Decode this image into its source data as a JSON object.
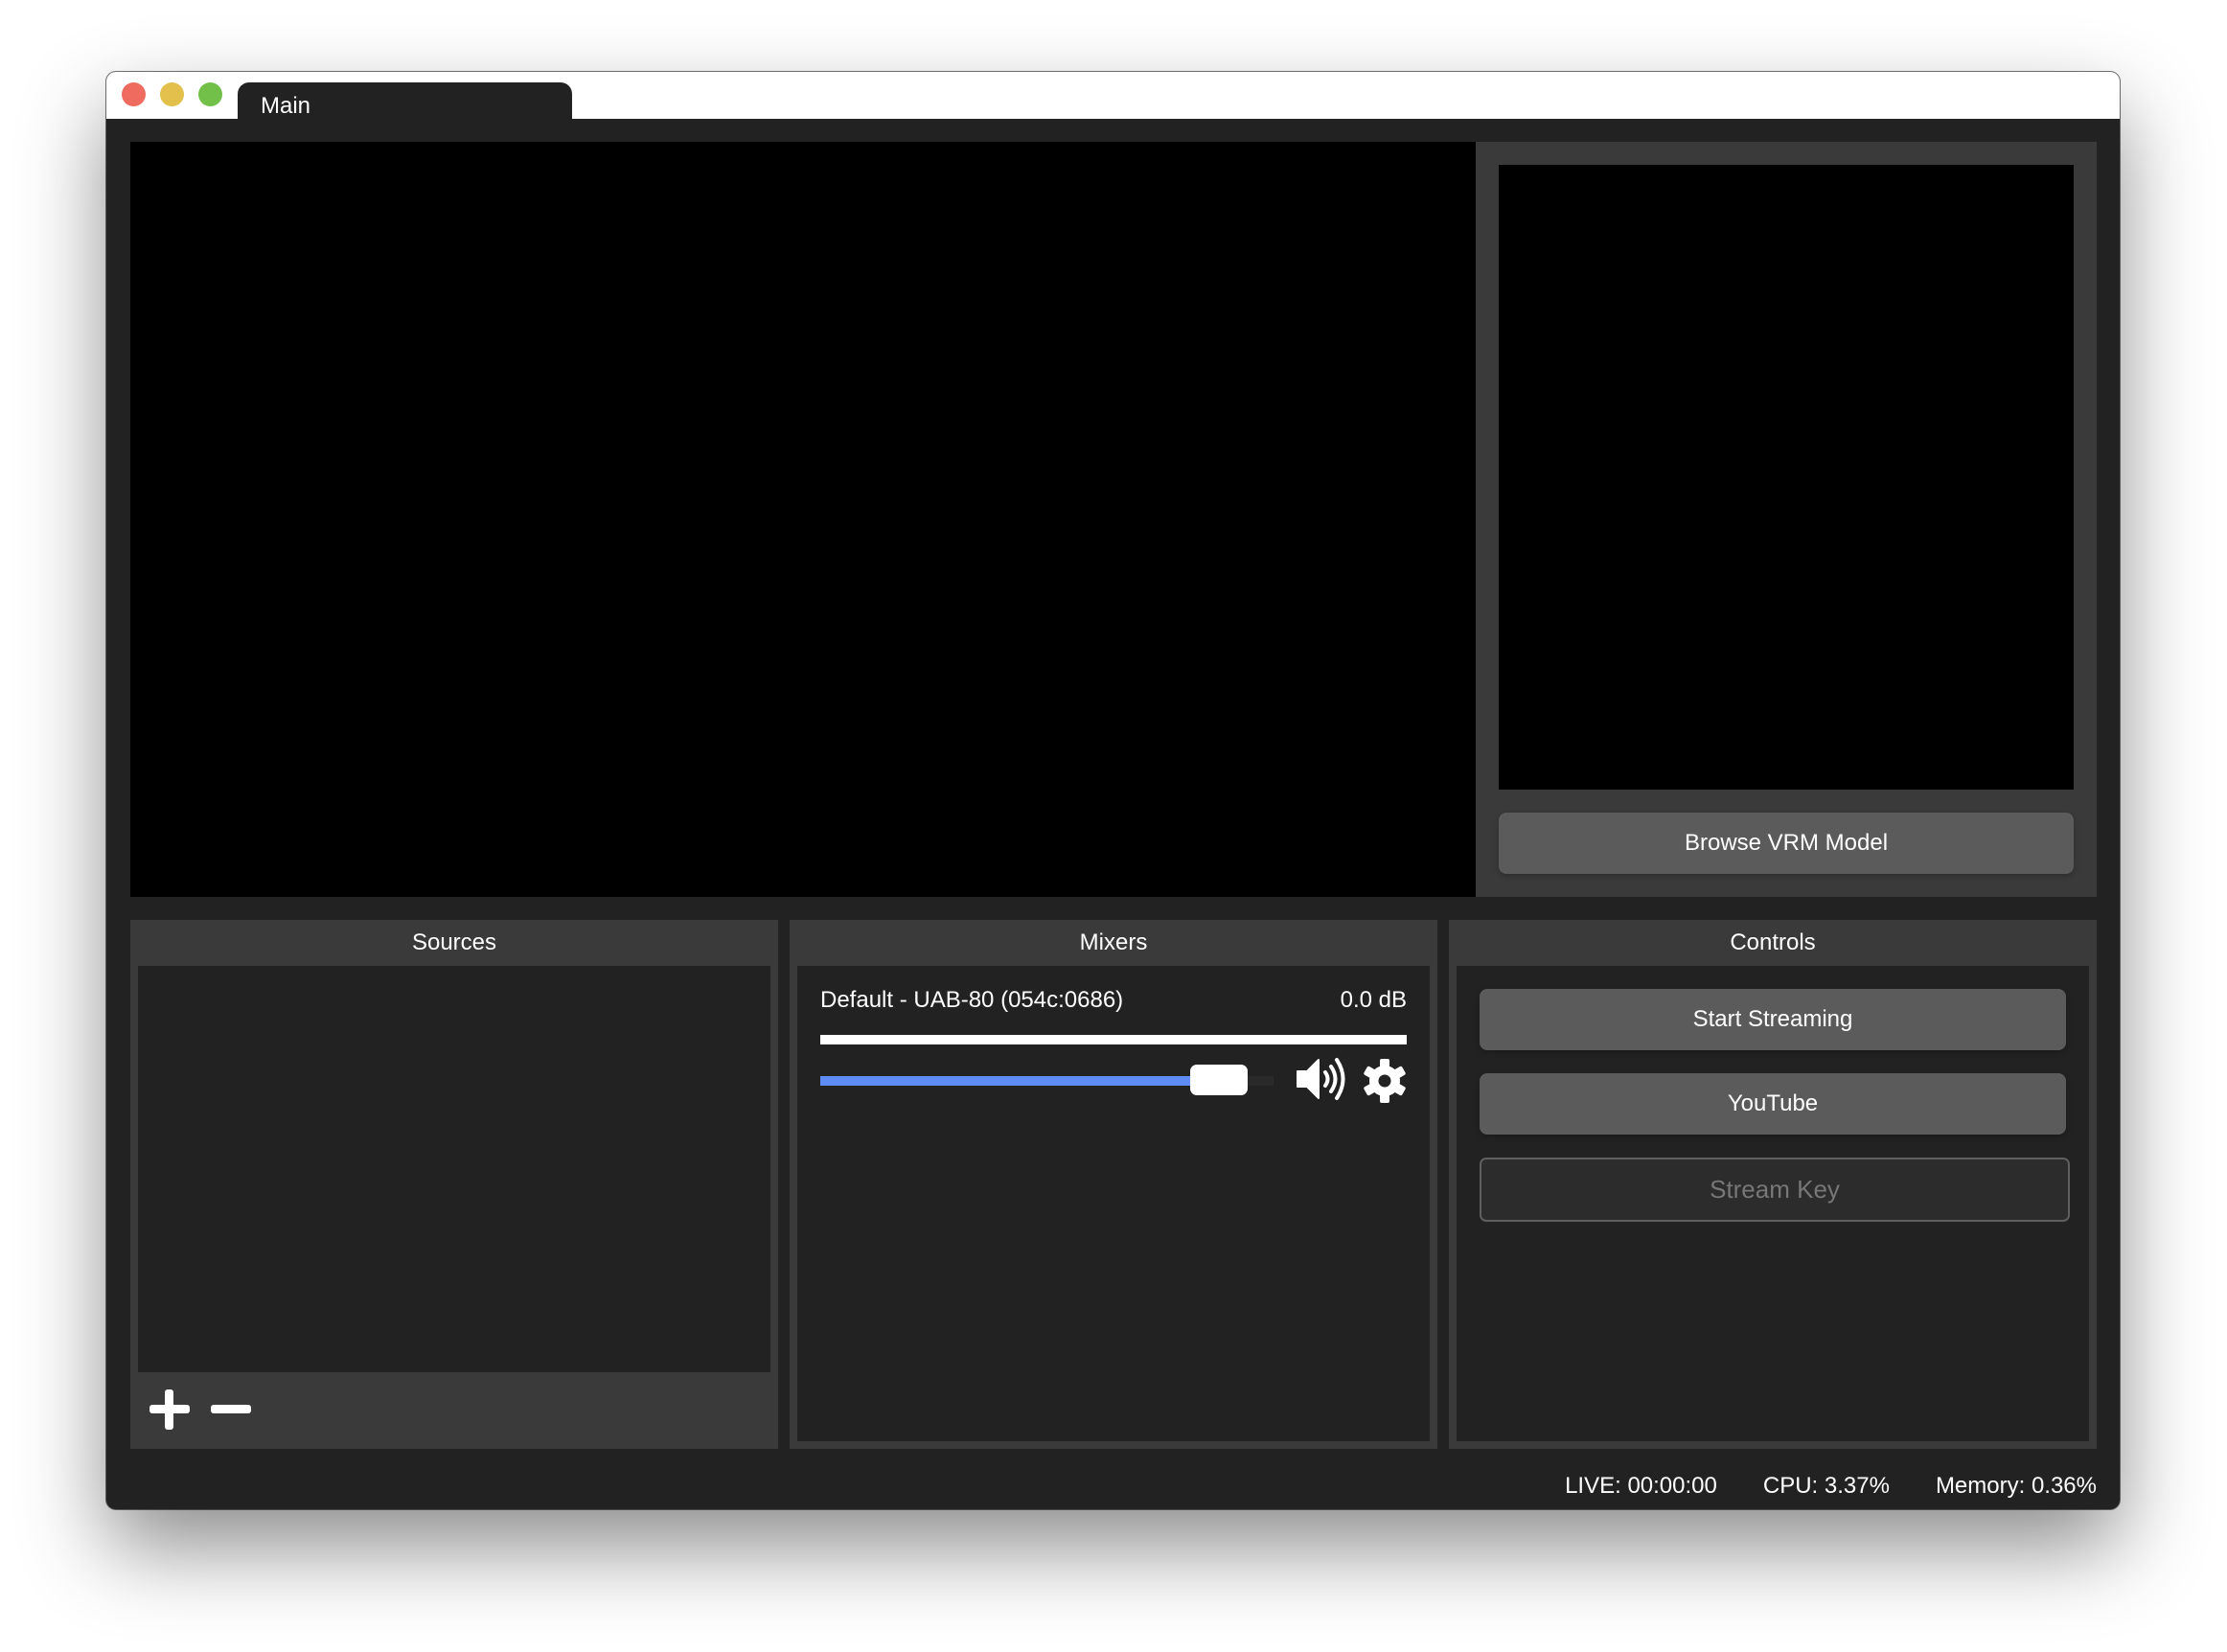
{
  "window": {
    "tab_label": "Main",
    "traffic_lights": {
      "close": "#ef6a5f",
      "minimize": "#e2c04b",
      "maximize": "#72c04a"
    }
  },
  "preview": {
    "browse_button_label": "Browse VRM Model"
  },
  "sources": {
    "title": "Sources",
    "items": [],
    "add_icon": "plus-icon",
    "remove_icon": "minus-icon"
  },
  "mixers": {
    "title": "Mixers",
    "devices": [
      {
        "name": "Default - UAB-80 (054c:0686)",
        "level_label": "0.0 dB",
        "volume_fraction": 0.88,
        "slider_color": "#5e8ef5",
        "mute_icon": "speaker-icon",
        "settings_icon": "gear-icon"
      }
    ]
  },
  "controls": {
    "title": "Controls",
    "start_streaming_label": "Start Streaming",
    "service_label": "YouTube",
    "stream_key_placeholder": "Stream Key",
    "stream_key_value": ""
  },
  "status": {
    "live": "LIVE: 00:00:00",
    "cpu": "CPU: 3.37%",
    "memory": "Memory: 0.36%"
  }
}
